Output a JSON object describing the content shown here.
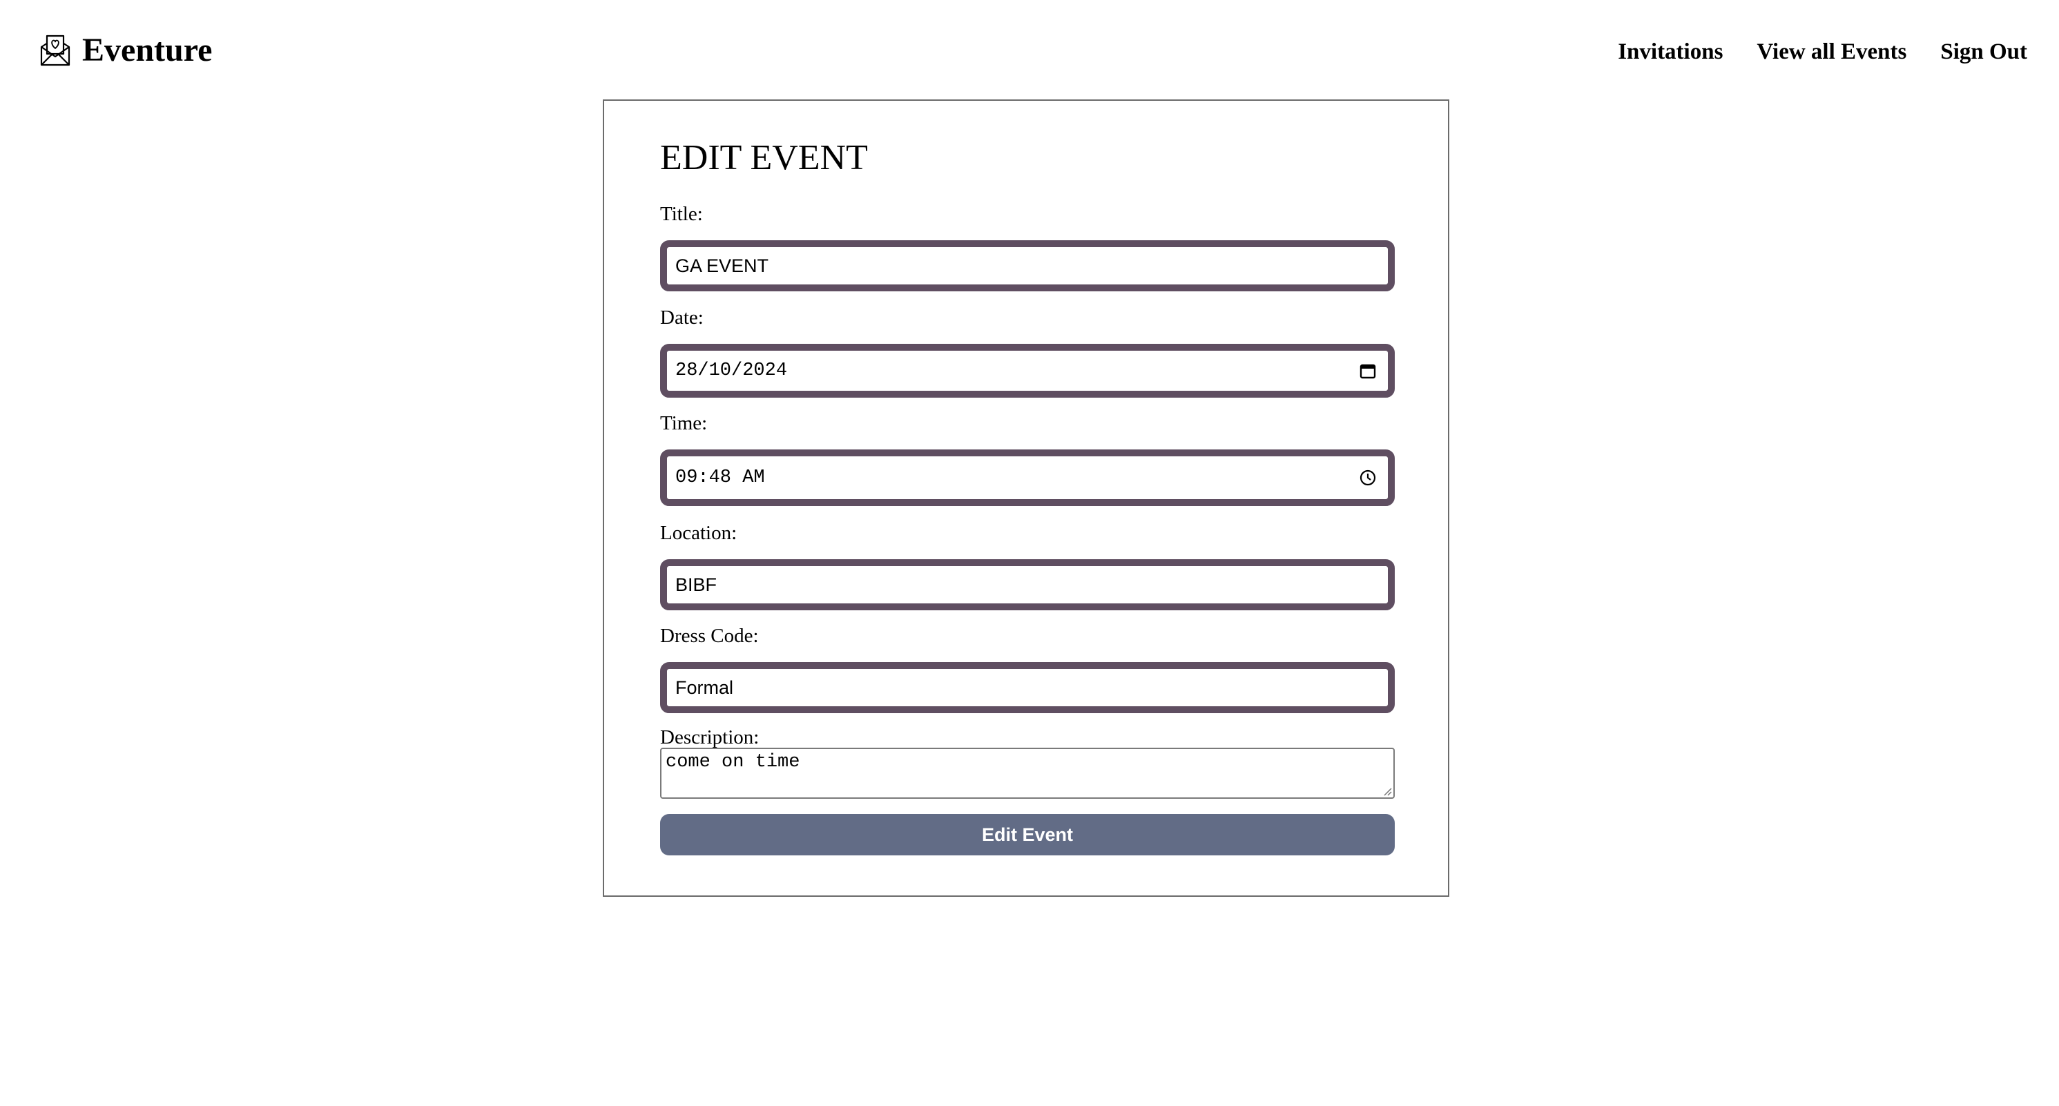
{
  "brand": {
    "name": "Eventure",
    "icon": "envelope-heart-icon"
  },
  "nav": {
    "links": [
      {
        "label": "Invitations"
      },
      {
        "label": "View all Events"
      },
      {
        "label": "Sign Out"
      }
    ]
  },
  "form": {
    "title": "EDIT EVENT",
    "fields": {
      "title": {
        "label": "Title:",
        "value": "GA EVENT"
      },
      "date": {
        "label": "Date:",
        "value": "28/10/2024",
        "icon": "calendar-icon"
      },
      "time": {
        "label": "Time:",
        "value": "09:48 AM",
        "icon": "clock-icon"
      },
      "location": {
        "label": "Location:",
        "value": "BIBF"
      },
      "dress_code": {
        "label": "Dress Code:",
        "value": "Formal"
      },
      "description": {
        "label": "Description:",
        "value": "come on time"
      }
    },
    "submit_label": "Edit Event"
  },
  "colors": {
    "field_border": "#5f4e61",
    "button_bg": "#626c86",
    "card_border": "#6b6b6b"
  }
}
